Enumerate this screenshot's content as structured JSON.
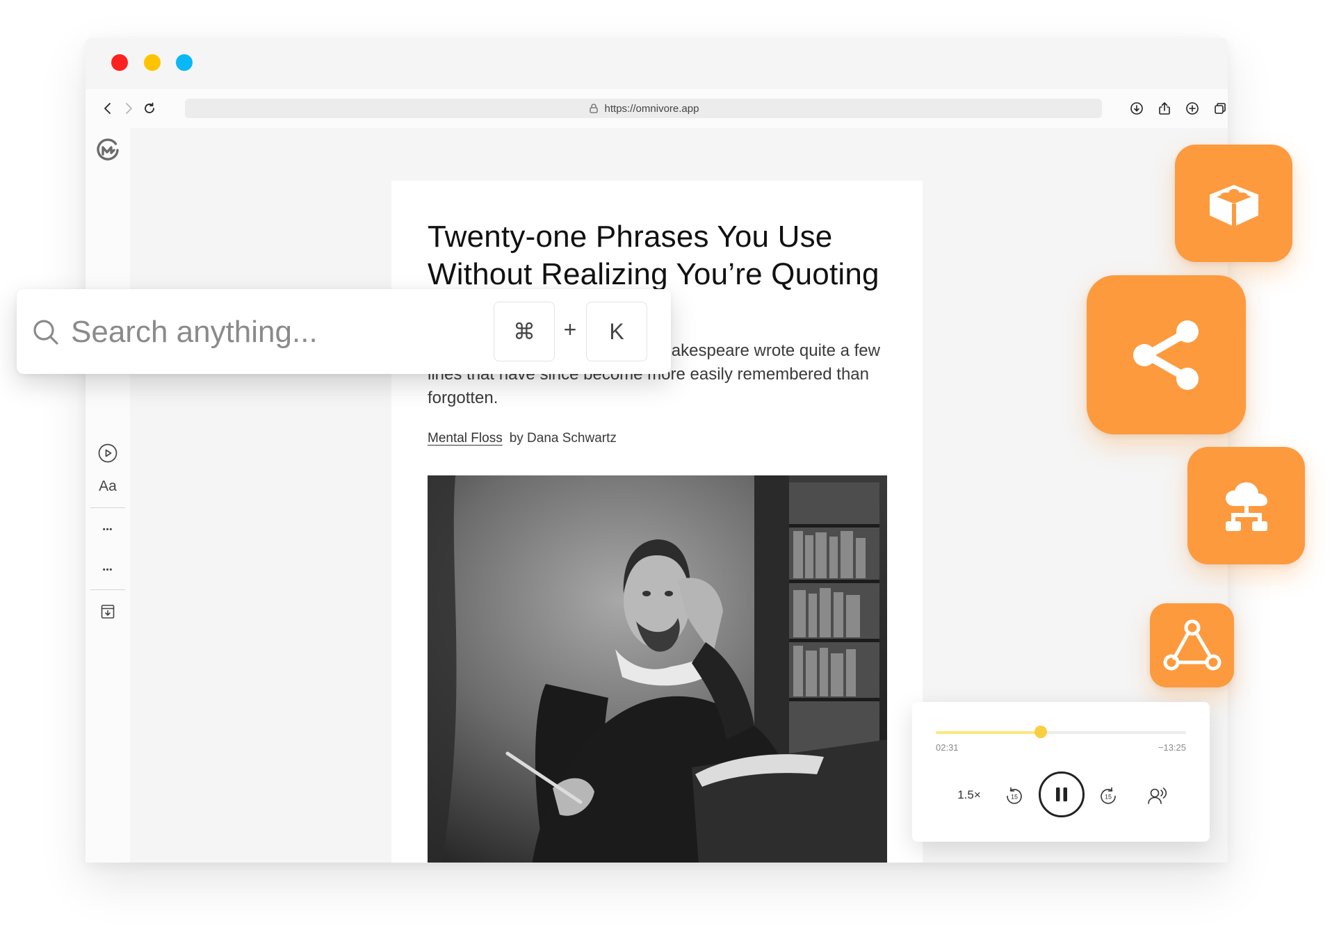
{
  "window": {
    "url": "https://omnivore.app"
  },
  "search": {
    "placeholder": "Search anything...",
    "shortcut_modifier": "⌘",
    "shortcut_plus": "+",
    "shortcut_key": "K"
  },
  "article": {
    "title": "Twenty-one Phrases You Use Without Realizing You’re Quoting Shakespeare",
    "description": "Love him or hate him, William Shakespeare wrote quite a few lines that have since become more easily remembered than forgotten.",
    "site_name": "Mental Floss",
    "byline": "by Dana Schwartz"
  },
  "sidebar": {
    "font_label": "Aa",
    "more_label_1": "•••",
    "more_label_2": "•••"
  },
  "player": {
    "elapsed": "02:31",
    "remaining": "−13:25",
    "speed": "1.5×",
    "skip_back_label": "15",
    "skip_forward_label": "15",
    "progress": 0.42
  },
  "app_tiles": [
    {
      "icon": "readwise-icon"
    },
    {
      "icon": "share-icon"
    },
    {
      "icon": "cloud-sync-icon"
    },
    {
      "icon": "webhook-icon"
    }
  ],
  "colors": {
    "accent_orange": "#fd9a3e",
    "progress_yellow": "#fbcd41",
    "traffic_red": "#ff2020",
    "traffic_yellow": "#ffc300",
    "traffic_blue": "#0ab8f5"
  }
}
